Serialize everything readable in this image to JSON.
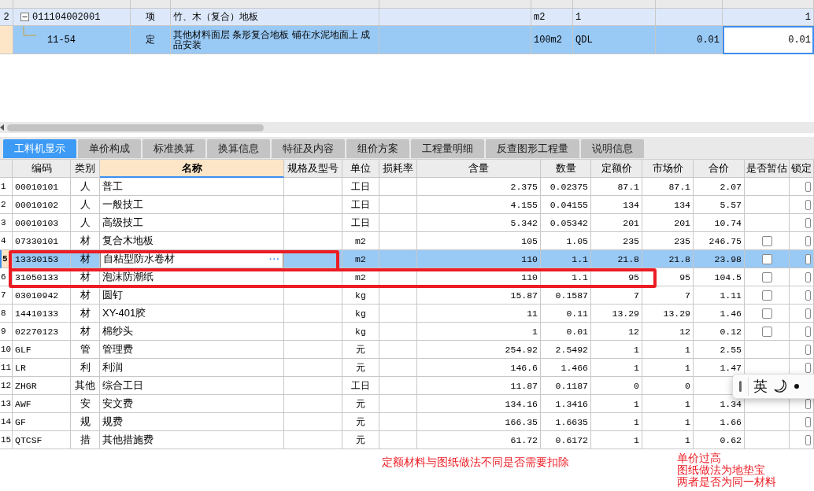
{
  "upper_grid": {
    "rows": [
      {
        "kind": "item",
        "row_number": "2",
        "expanded": true,
        "code": "011104002001",
        "category": "项",
        "name": "竹、木（复合）地板",
        "unit": "m2",
        "expression": "1",
        "quantity": "1",
        "selected": false
      },
      {
        "kind": "sub",
        "code": "11-54",
        "category": "定",
        "name": "其他材料面层 条形复合地板 铺在水泥地面上 成品安装",
        "unit": "100m2",
        "expression": "QDL",
        "content": "0.01",
        "quantity": "0.01",
        "selected": true
      }
    ]
  },
  "tabs": [
    {
      "label": "工料机显示",
      "selected": true
    },
    {
      "label": "单价构成",
      "selected": false
    },
    {
      "label": "标准换算",
      "selected": false
    },
    {
      "label": "换算信息",
      "selected": false
    },
    {
      "label": "特征及内容",
      "selected": false
    },
    {
      "label": "组价方案",
      "selected": false
    },
    {
      "label": "工程量明细",
      "selected": false
    },
    {
      "label": "反查图形工程量",
      "selected": false
    },
    {
      "label": "说明信息",
      "selected": false
    }
  ],
  "table": {
    "columns": [
      {
        "label": "编码",
        "selected": false
      },
      {
        "label": "类别",
        "selected": false
      },
      {
        "label": "名称",
        "selected": true
      },
      {
        "label": "规格及型号",
        "selected": false
      },
      {
        "label": "单位",
        "selected": false
      },
      {
        "label": "损耗率",
        "selected": false
      },
      {
        "label": "含量",
        "selected": false
      },
      {
        "label": "数量",
        "selected": false
      },
      {
        "label": "定额价",
        "selected": false
      },
      {
        "label": "市场价",
        "selected": false
      },
      {
        "label": "合价",
        "selected": false
      },
      {
        "label": "是否暂估",
        "selected": false
      },
      {
        "label": "锁定",
        "selected": false
      }
    ],
    "rows": [
      {
        "row_number": "1",
        "code": "00010101",
        "category": "人",
        "name": "普工",
        "unit": "工日",
        "content": "2.375",
        "amount": "0.02375",
        "quota_price": "87.1",
        "market_price": "87.1",
        "total": "2.07",
        "locked": false,
        "selected": false
      },
      {
        "row_number": "2",
        "code": "00010102",
        "category": "人",
        "name": "一般技工",
        "unit": "工日",
        "content": "4.155",
        "amount": "0.04155",
        "quota_price": "134",
        "market_price": "134",
        "total": "5.57",
        "locked": false,
        "selected": false
      },
      {
        "row_number": "3",
        "code": "00010103",
        "category": "人",
        "name": "高级技工",
        "unit": "工日",
        "content": "5.342",
        "amount": "0.05342",
        "quota_price": "201",
        "market_price": "201",
        "total": "10.74",
        "locked": false,
        "selected": false
      },
      {
        "row_number": "4",
        "code": "07330101",
        "category": "材",
        "name": "复合木地板",
        "unit": "m2",
        "content": "105",
        "amount": "1.05",
        "quota_price": "235",
        "market_price": "235",
        "total": "246.75",
        "provisional": false,
        "locked": false,
        "selected": false
      },
      {
        "row_number": "5",
        "code": "13330153",
        "category": "材",
        "name": "自粘型防水卷材",
        "editor_button": "···",
        "unit": "m2",
        "content": "110",
        "amount": "1.1",
        "quota_price": "21.8",
        "market_price": "21.8",
        "total": "23.98",
        "provisional": false,
        "locked": false,
        "selected": true
      },
      {
        "row_number": "6",
        "code": "31050133",
        "category": "材",
        "name": "泡沫防潮纸",
        "unit": "m2",
        "content": "110",
        "amount": "1.1",
        "quota_price": "95",
        "market_price": "95",
        "total": "104.5",
        "provisional": false,
        "locked": false,
        "selected": false
      },
      {
        "row_number": "7",
        "code": "03010942",
        "category": "材",
        "name": "圆钉",
        "unit": "kg",
        "content": "15.87",
        "amount": "0.1587",
        "quota_price": "7",
        "market_price": "7",
        "total": "1.11",
        "provisional": false,
        "locked": false,
        "selected": false
      },
      {
        "row_number": "8",
        "code": "14410133",
        "category": "材",
        "name": "XY-401胶",
        "unit": "kg",
        "content": "11",
        "amount": "0.11",
        "quota_price": "13.29",
        "market_price": "13.29",
        "total": "1.46",
        "provisional": false,
        "locked": false,
        "selected": false
      },
      {
        "row_number": "9",
        "code": "02270123",
        "category": "材",
        "name": "棉纱头",
        "unit": "kg",
        "content": "1",
        "amount": "0.01",
        "quota_price": "12",
        "market_price": "12",
        "total": "0.12",
        "provisional": false,
        "locked": false,
        "selected": false
      },
      {
        "row_number": "10",
        "code": "GLF",
        "category": "管",
        "name": "管理费",
        "unit": "元",
        "content": "254.92",
        "amount": "2.5492",
        "quota_price": "1",
        "market_price": "1",
        "total": "2.55",
        "locked": false,
        "selected": false
      },
      {
        "row_number": "11",
        "code": "LR",
        "category": "利",
        "name": "利润",
        "unit": "元",
        "content": "146.6",
        "amount": "1.466",
        "quota_price": "1",
        "market_price": "1",
        "total": "1.47",
        "locked": false,
        "selected": false
      },
      {
        "row_number": "12",
        "code": "ZHGR",
        "category": "其他",
        "name": "综合工日",
        "unit": "工日",
        "content": "11.87",
        "amount": "0.1187",
        "quota_price": "0",
        "market_price": "0",
        "selected": false
      },
      {
        "row_number": "13",
        "code": "AWF",
        "category": "安",
        "name": "安文费",
        "unit": "元",
        "content": "134.16",
        "amount": "1.3416",
        "quota_price": "1",
        "market_price": "1",
        "total": "1.34",
        "locked": false,
        "selected": false
      },
      {
        "row_number": "14",
        "code": "GF",
        "category": "规",
        "name": "规费",
        "unit": "元",
        "content": "166.35",
        "amount": "1.6635",
        "quota_price": "1",
        "market_price": "1",
        "total": "1.66",
        "locked": false,
        "selected": false
      },
      {
        "row_number": "15",
        "code": "QTCSF",
        "category": "措",
        "name": "其他措施费",
        "unit": "元",
        "content": "61.72",
        "amount": "0.6172",
        "quota_price": "1",
        "market_price": "1",
        "total": "0.62",
        "locked": false,
        "selected": false
      }
    ]
  },
  "annotations": [
    {
      "lines": [
        "定额材料与图纸做法不同是否需要扣除"
      ]
    },
    {
      "lines": [
        "单价过高",
        "图纸做法为地垫宝",
        "两者是否为同一材料"
      ]
    }
  ],
  "ime_toolbar": {
    "mode": "英"
  }
}
